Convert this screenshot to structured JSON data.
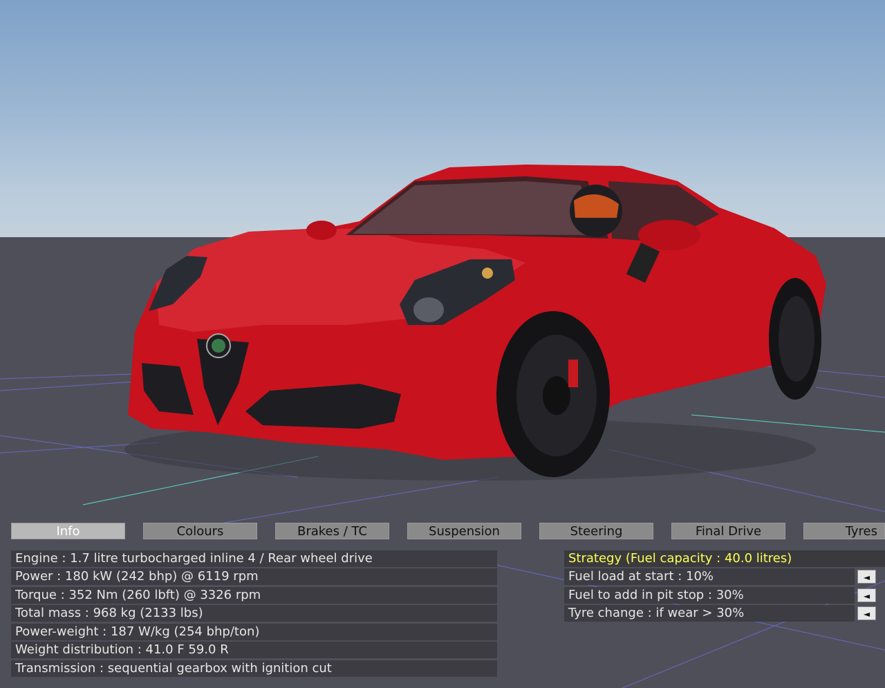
{
  "tabs": [
    {
      "label": "Info",
      "active": true
    },
    {
      "label": "Colours",
      "active": false
    },
    {
      "label": "Brakes / TC",
      "active": false
    },
    {
      "label": "Suspension",
      "active": false
    },
    {
      "label": "Steering",
      "active": false
    },
    {
      "label": "Final Drive",
      "active": false
    },
    {
      "label": "Tyres",
      "active": false
    }
  ],
  "info": {
    "engine": "Engine : 1.7 litre turbocharged inline 4 / Rear wheel drive",
    "power": "Power : 180 kW (242 bhp) @ 6119 rpm",
    "torque": "Torque : 352 Nm (260 lbft) @ 3326 rpm",
    "mass": "Total mass : 968 kg (2133 lbs)",
    "power_weight": "Power-weight : 187 W/kg (254 bhp/ton)",
    "weight_distribution": "Weight distribution : 41.0 F  59.0 R",
    "transmission": "Transmission : sequential gearbox with ignition cut"
  },
  "strategy": {
    "title": "Strategy (Fuel capacity : 40.0 litres)",
    "fuel_load": "Fuel load at start : 10%",
    "fuel_add": "Fuel to add in pit stop : 30%",
    "tyre_change": "Tyre change : if wear > 30%",
    "arrow_glyph": "◄"
  },
  "colors": {
    "car_body": "#c8121e",
    "header_text": "#ffff55",
    "panel_row": "#3c3c42"
  }
}
